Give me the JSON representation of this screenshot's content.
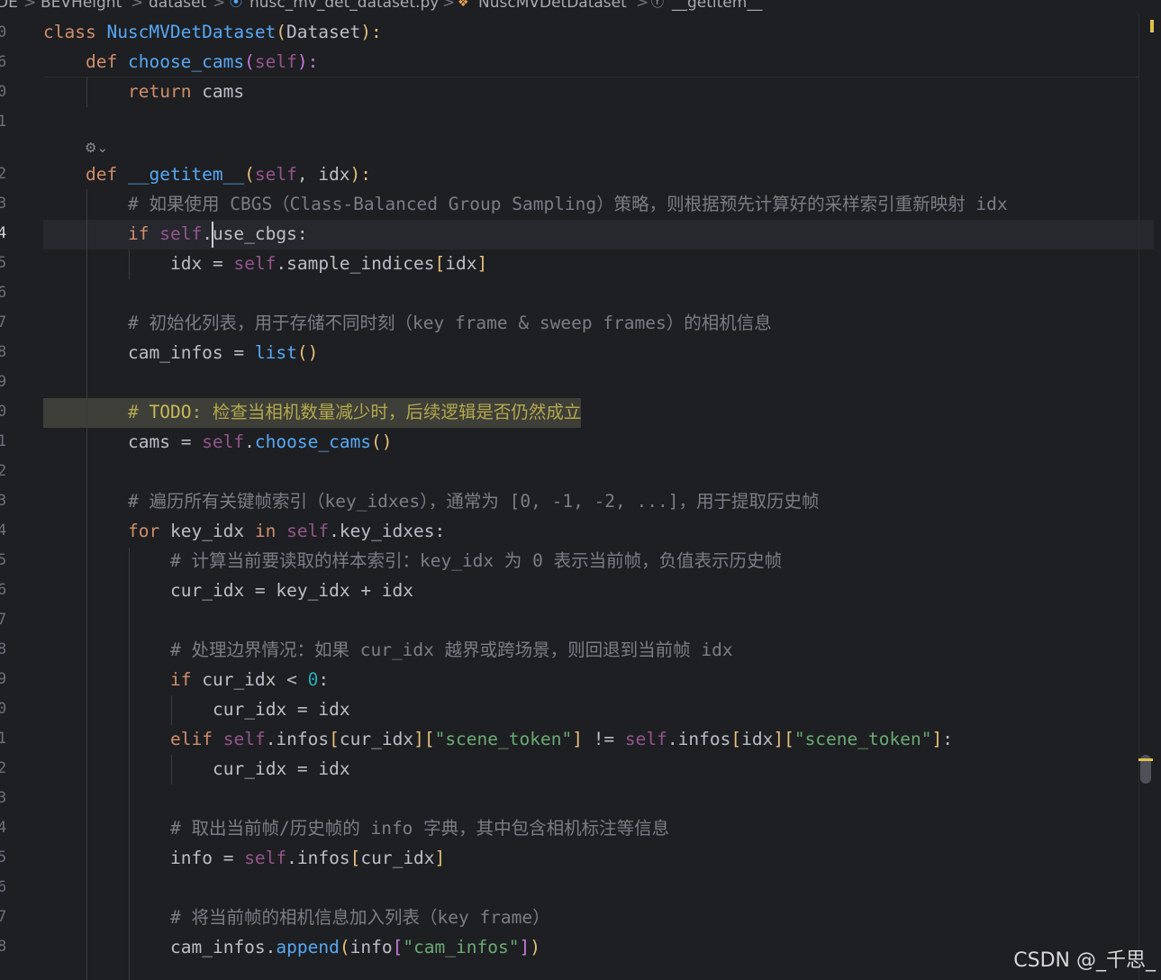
{
  "breadcrumb": {
    "items": [
      "DE",
      "BEVHeight",
      "dataset",
      "nusc_mv_det_dataset.py",
      "NuscMVDetDataset",
      "__getitem__"
    ],
    "separator": ">"
  },
  "gutter": {
    "line_numbers": [
      "0",
      "6",
      "0",
      "1",
      "",
      "2",
      "3",
      "4",
      "5",
      "6",
      "7",
      "8",
      "9",
      "0",
      "1",
      "2",
      "3",
      "4",
      "5",
      "6",
      "7",
      "8",
      "9",
      "0",
      "1",
      "2",
      "3",
      "4",
      "5",
      "6",
      "7",
      "8"
    ]
  },
  "code": {
    "l01": {
      "kw": "class",
      "name": "NuscMVDetDataset",
      "p1": "(",
      "base": "Dataset",
      "p2": "):"
    },
    "l02": {
      "kw": "def",
      "name": "choose_cams",
      "p1": "(",
      "self": "self",
      "p2": "):"
    },
    "l03": {
      "kw": "return",
      "rest": " cams"
    },
    "l04": {
      "hint": "⚙⌄"
    },
    "l05": {
      "kw": "def",
      "name": "__getitem__",
      "p1": "(",
      "self": "self",
      "args": ", idx",
      "p2": "):"
    },
    "l06": {
      "comment": "# 如果使用 CBGS（Class-Balanced Group Sampling）策略，则根据预先计算好的采样索引重新映射 idx"
    },
    "l07": {
      "kw": "if",
      "self": "self",
      "rest": ".use_cbgs:"
    },
    "l08": {
      "a": "idx = ",
      "self": "self",
      "b": ".sample_indices",
      "o": "[",
      "idx": "idx",
      "c": "]"
    },
    "l09": {
      "comment": "# 初始化列表，用于存储不同时刻（key frame & sweep frames）的相机信息"
    },
    "l10": {
      "a": "cam_infos = ",
      "fn": "list",
      "p": "()"
    },
    "l11": {
      "todo_hash": "# ",
      "todo": "TODO",
      "comment": ": 检查当相机数量减少时，后续逻辑是否仍然成立"
    },
    "l12": {
      "a": "cams = ",
      "self": "self",
      "dot": ".",
      "fn": "choose_cams",
      "p": "()"
    },
    "l13": {
      "comment": "# 遍历所有关键帧索引（key_idxes），通常为 [0, -1, -2, ...]，用于提取历史帧"
    },
    "l14": {
      "kw": "for",
      "a": " key_idx ",
      "kw2": "in",
      "b": " ",
      "self": "self",
      "rest": ".key_idxes:"
    },
    "l15": {
      "comment": "# 计算当前要读取的样本索引：key_idx 为 0 表示当前帧，负值表示历史帧"
    },
    "l16": {
      "rest": "cur_idx = key_idx + idx"
    },
    "l17": {
      "comment": "# 处理边界情况：如果 cur_idx 越界或跨场景，则回退到当前帧 idx"
    },
    "l18": {
      "kw": "if",
      "a": " cur_idx < ",
      "num": "0",
      "b": ":"
    },
    "l19": {
      "rest": "cur_idx = idx"
    },
    "l20": {
      "kw": "elif",
      "b1": " ",
      "self1": "self",
      "c1": ".infos",
      "o1": "[",
      "i1": "cur_idx",
      "c2": "]",
      "o2": "[",
      "s1": "\"scene_token\"",
      "c3": "]",
      "op": " != ",
      "self2": "self",
      "c4": ".infos",
      "o3": "[",
      "i2": "idx",
      "c5": "]",
      "o4": "[",
      "s2": "\"scene_token\"",
      "c6": "]",
      "end": ":"
    },
    "l21": {
      "rest": "cur_idx = idx"
    },
    "l22": {
      "comment": "# 取出当前帧/历史帧的 info 字典，其中包含相机标注等信息"
    },
    "l23": {
      "a": "info = ",
      "self": "self",
      "b": ".infos",
      "o": "[",
      "i": "cur_idx",
      "c": "]"
    },
    "l24": {
      "comment": "# 将当前帧的相机信息加入列表（key frame）"
    },
    "l25": {
      "a": "cam_infos.",
      "fn": "append",
      "o": "(",
      "b": "info",
      "o2": "[",
      "s": "\"cam_infos\"",
      "c2": "]",
      "c": ")"
    }
  },
  "watermark": "CSDN @_千思_",
  "colors": {
    "background": "#1e1f22",
    "keyword": "#cf8e6d",
    "function": "#56a8f5",
    "self": "#94558d",
    "string": "#6aab73",
    "number": "#2aacb8",
    "comment": "#7a7e85",
    "todo": "#b4a84e"
  }
}
